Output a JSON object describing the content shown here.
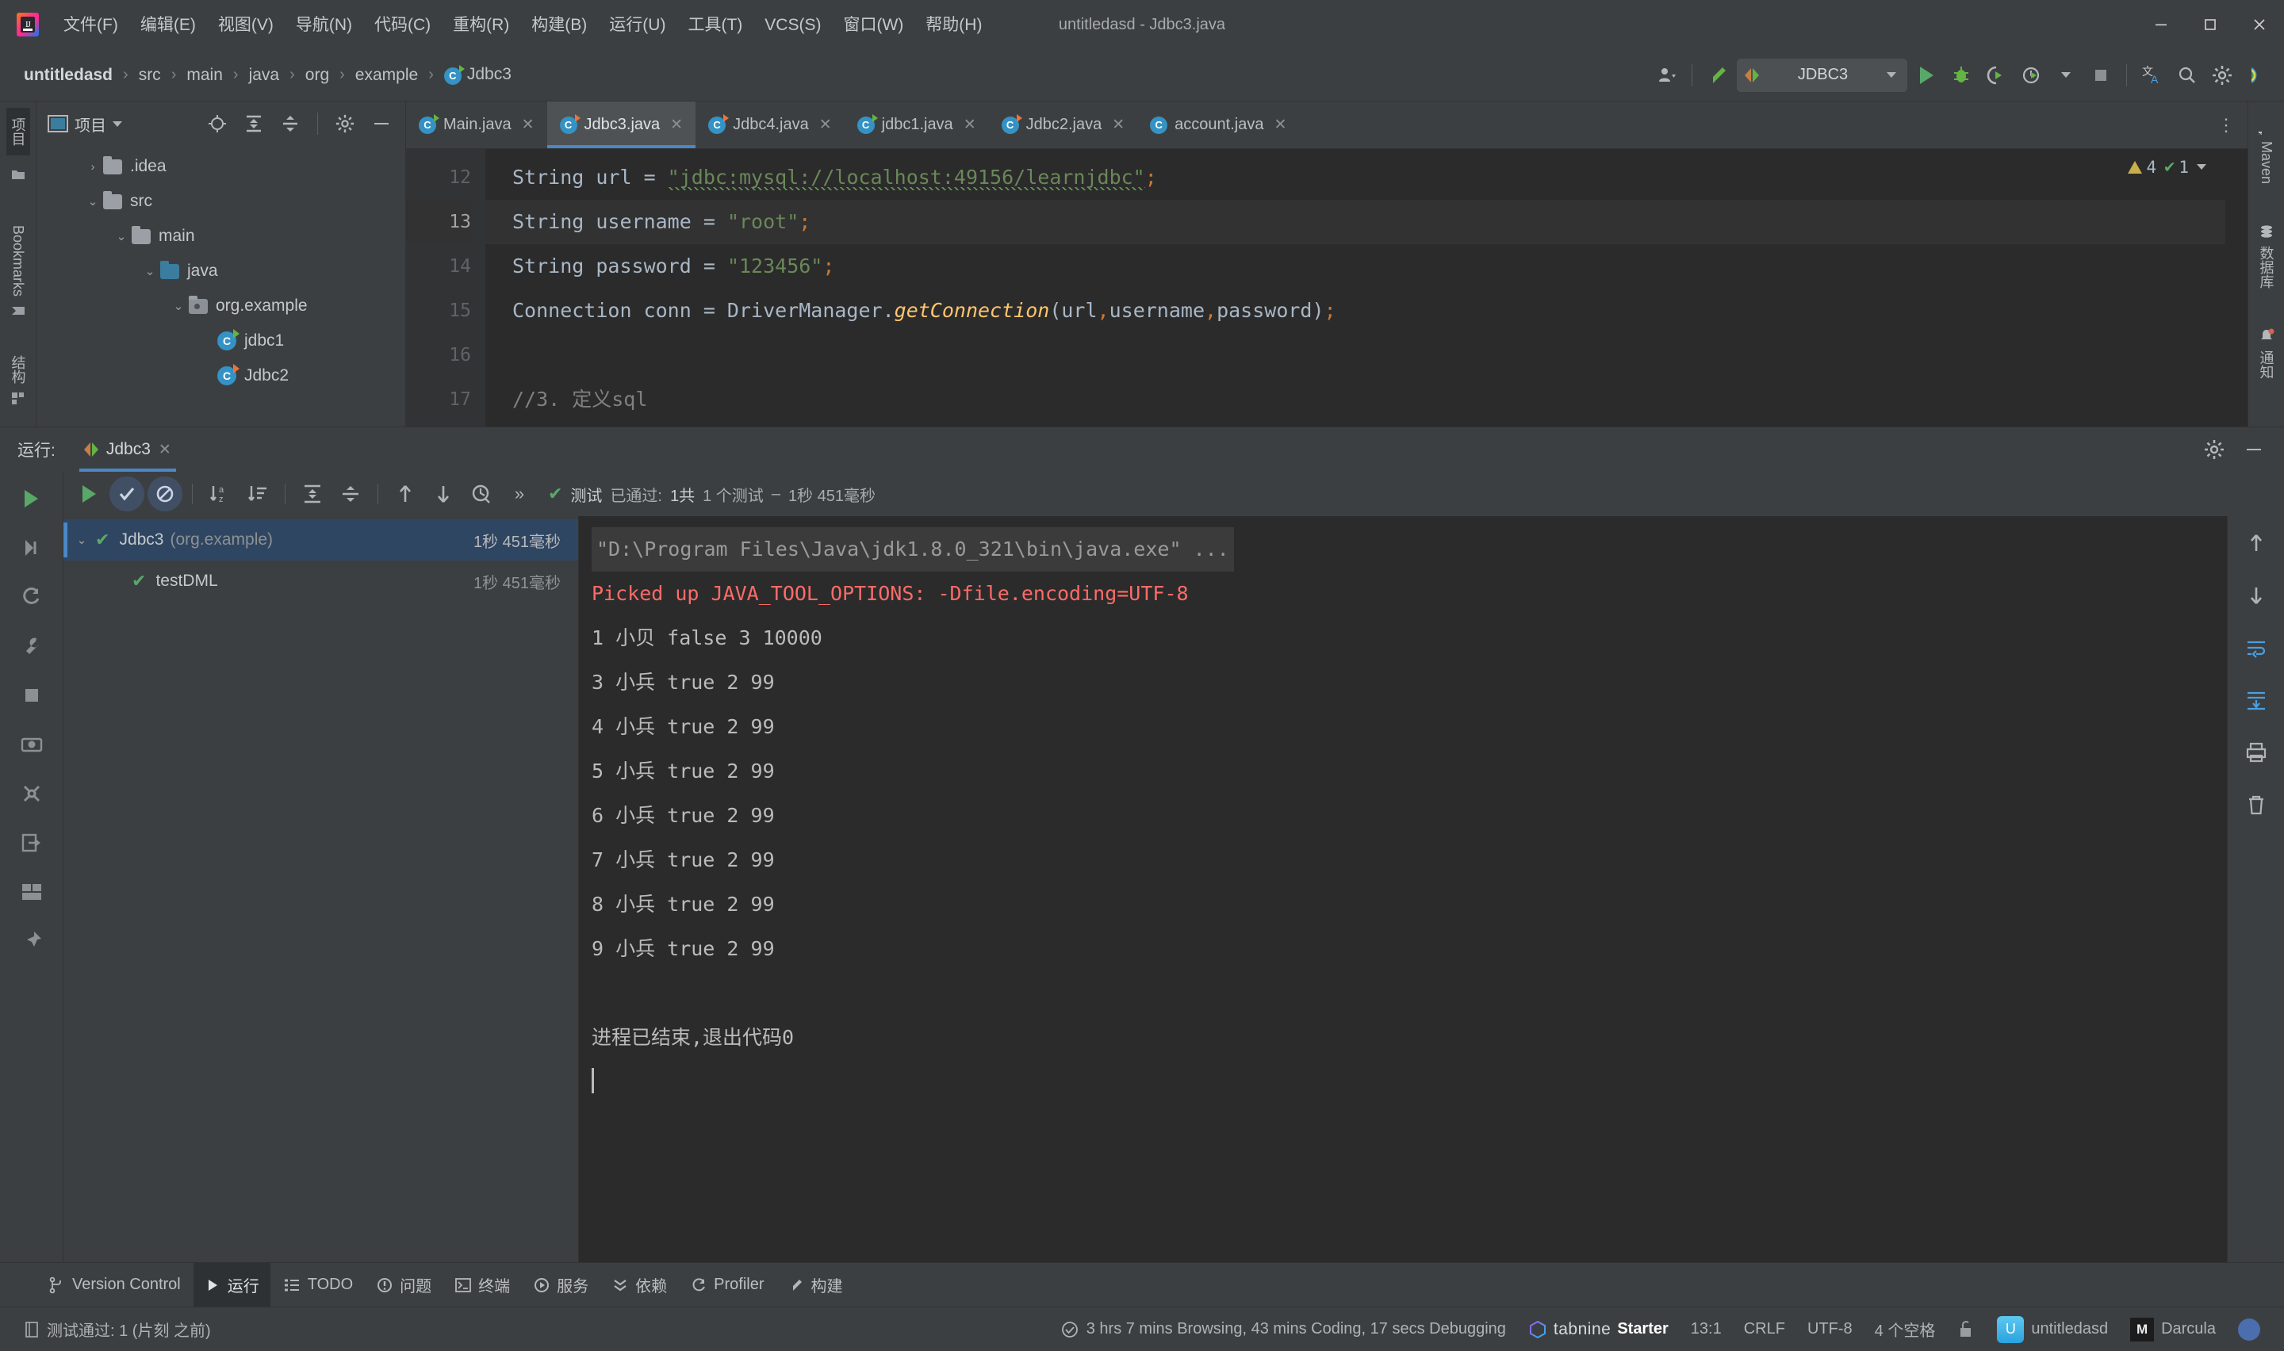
{
  "window": {
    "title": "untitledasd - Jdbc3.java",
    "minimize": "—",
    "maximize": "▢",
    "close": "✕"
  },
  "menu": {
    "items": [
      {
        "label": "文件(F)",
        "name": "menu-file"
      },
      {
        "label": "编辑(E)",
        "name": "menu-edit"
      },
      {
        "label": "视图(V)",
        "name": "menu-view"
      },
      {
        "label": "导航(N)",
        "name": "menu-navigate"
      },
      {
        "label": "代码(C)",
        "name": "menu-code"
      },
      {
        "label": "重构(R)",
        "name": "menu-refactor"
      },
      {
        "label": "构建(B)",
        "name": "menu-build"
      },
      {
        "label": "运行(U)",
        "name": "menu-run"
      },
      {
        "label": "工具(T)",
        "name": "menu-tools"
      },
      {
        "label": "VCS(S)",
        "name": "menu-vcs"
      },
      {
        "label": "窗口(W)",
        "name": "menu-window"
      },
      {
        "label": "帮助(H)",
        "name": "menu-help"
      }
    ]
  },
  "breadcrumb": {
    "items": [
      "untitledasd",
      "src",
      "main",
      "java",
      "org",
      "example",
      "Jdbc3"
    ],
    "separator": "›"
  },
  "toolbar": {
    "run_config": "JDBC3",
    "icons": [
      "user-icon",
      "hammer-icon",
      "run-icon",
      "debug-icon",
      "run-coverage-icon",
      "profile-icon",
      "stop-icon",
      "translate-icon",
      "search-icon",
      "settings-icon",
      "ai-icon"
    ]
  },
  "project_panel": {
    "title": "项目",
    "tree": [
      {
        "label": ".idea",
        "type": "folder",
        "depth": 1,
        "twist": "›"
      },
      {
        "label": "src",
        "type": "folder",
        "depth": 1,
        "twist": "⌄"
      },
      {
        "label": "main",
        "type": "folder",
        "depth": 2,
        "twist": "⌄"
      },
      {
        "label": "java",
        "type": "folder-blue",
        "depth": 3,
        "twist": "⌄"
      },
      {
        "label": "org.example",
        "type": "package",
        "depth": 4,
        "twist": "⌄"
      },
      {
        "label": "jdbc1",
        "type": "class",
        "depth": 5,
        "twist": ""
      },
      {
        "label": "Jdbc2",
        "type": "class-orange",
        "depth": 5,
        "twist": ""
      }
    ]
  },
  "left_strip": {
    "project_label": "项目",
    "bookmarks_label": "Bookmarks",
    "structure_label": "结构"
  },
  "right_strip": {
    "maven_label": "Maven",
    "database_label": "数据库",
    "notifications_label": "通知"
  },
  "editor": {
    "tabs": [
      {
        "label": "Main.java",
        "active": false,
        "icon": "java-class-icon"
      },
      {
        "label": "Jdbc3.java",
        "active": true,
        "icon": "java-class-icon-orange"
      },
      {
        "label": "Jdbc4.java",
        "active": false,
        "icon": "java-class-icon-orange"
      },
      {
        "label": "jdbc1.java",
        "active": false,
        "icon": "java-class-icon"
      },
      {
        "label": "Jdbc2.java",
        "active": false,
        "icon": "java-class-icon-orange"
      },
      {
        "label": "account.java",
        "active": false,
        "icon": "java-class-icon-plain"
      }
    ],
    "line_numbers": [
      "12",
      "13",
      "14",
      "15",
      "16",
      "17"
    ],
    "code": [
      {
        "n": "12",
        "current": false
      },
      {
        "n": "13",
        "current": true
      },
      {
        "n": "14",
        "current": false
      },
      {
        "n": "15",
        "current": false
      },
      {
        "n": "16",
        "current": false
      },
      {
        "n": "17",
        "current": false
      }
    ],
    "tokens": {
      "l12_type": "String",
      "l12_var": " url = ",
      "l12_str": "\"jdbc:mysql://localhost:49156/learnjdbc\"",
      "l12_semi": ";",
      "l13_type": "String",
      "l13_var": " username = ",
      "l13_str": "\"root\"",
      "l13_semi": ";",
      "l14_type": "String",
      "l14_var": " password = ",
      "l14_str": "\"123456\"",
      "l14_semi": ";",
      "l15_a": "Connection conn = DriverManager.",
      "l15_m": "getConnection",
      "l15_b": "(url",
      "l15_c1": ",",
      "l15_d": "username",
      "l15_c2": ",",
      "l15_e": "password",
      "l15_f": ")",
      "l15_semi": ";",
      "l17_comment": "//3. 定义sql"
    },
    "inspections": {
      "warnings": "4",
      "oks": "1",
      "chevron": "⌄"
    }
  },
  "run_window": {
    "label": "运行:",
    "tab": "Jdbc3",
    "close": "✕",
    "status": {
      "prefix": "测试",
      "passed_label": "已通过:",
      "passed_count": "1共",
      "total": "1 个测试",
      "dash": "–",
      "duration": "1秒 451毫秒"
    },
    "test_tree": [
      {
        "label": "Jdbc3",
        "pkg": "(org.example)",
        "duration": "1秒 451毫秒",
        "selected": true,
        "twist": "⌄"
      },
      {
        "label": "testDML",
        "pkg": "",
        "duration": "1秒 451毫秒",
        "selected": false,
        "twist": ""
      }
    ],
    "console": {
      "command": "\"D:\\Program Files\\Java\\jdk1.8.0_321\\bin\\java.exe\" ...",
      "warning": "Picked up JAVA_TOOL_OPTIONS: -Dfile.encoding=UTF-8",
      "rows": [
        "1 小贝 false 3 10000",
        "3 小兵 true 2 99",
        "4 小兵 true 2 99",
        "5 小兵 true 2 99",
        "6 小兵 true 2 99",
        "7 小兵 true 2 99",
        "8 小兵 true 2 99",
        "9 小兵 true 2 99"
      ],
      "exit": "进程已结束,退出代码0"
    }
  },
  "bottom_bar": {
    "items": [
      {
        "label": "Version Control",
        "icon": "branch-icon",
        "selected": false
      },
      {
        "label": "运行",
        "icon": "play-icon",
        "selected": true
      },
      {
        "label": "TODO",
        "icon": "list-icon",
        "selected": false
      },
      {
        "label": "问题",
        "icon": "error-icon",
        "selected": false
      },
      {
        "label": "终端",
        "icon": "terminal-icon",
        "selected": false
      },
      {
        "label": "服务",
        "icon": "services-icon",
        "selected": false
      },
      {
        "label": "依赖",
        "icon": "dependencies-icon",
        "selected": false
      },
      {
        "label": "Profiler",
        "icon": "profiler-icon",
        "selected": false
      },
      {
        "label": "构建",
        "icon": "build-icon",
        "selected": false
      }
    ]
  },
  "status_bar": {
    "left": "测试通过: 1 (片刻 之前)",
    "wakatime": "3 hrs 7 mins Browsing, 43 mins Coding, 17 secs Debugging",
    "tabnine_name": "tabnine",
    "tabnine_state": "Starter",
    "caret": "13:1",
    "line_sep": "CRLF",
    "encoding": "UTF-8",
    "indent": "4 个空格",
    "lock": "lock-icon",
    "branch_badge": "U",
    "project": "untitledasd",
    "theme": "Darcula"
  }
}
